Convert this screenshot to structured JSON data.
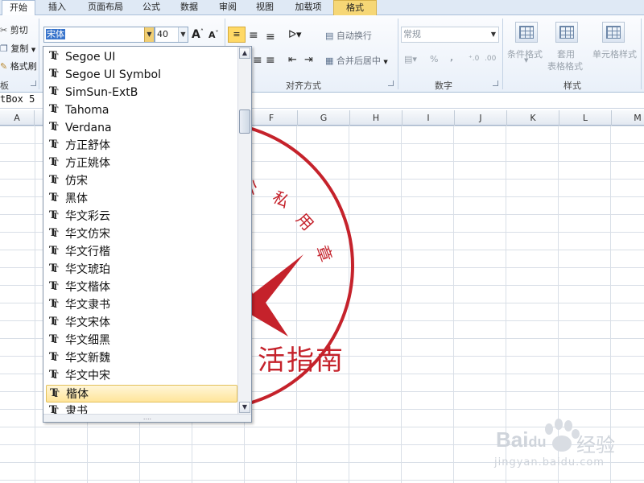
{
  "tabs": [
    {
      "label": "开始",
      "active": true
    },
    {
      "label": "插入"
    },
    {
      "label": "页面布局"
    },
    {
      "label": "公式"
    },
    {
      "label": "数据"
    },
    {
      "label": "审阅"
    },
    {
      "label": "视图"
    },
    {
      "label": "加载项"
    },
    {
      "label": "格式",
      "contextual": true
    }
  ],
  "clipboard": {
    "cut_label": "剪切",
    "copy_label": "复制",
    "format_painter_label": "格式刷",
    "group_label": "板"
  },
  "font": {
    "name_value": "宋体",
    "size_value": "40",
    "grow_label": "A",
    "shrink_label": "A"
  },
  "alignment": {
    "wrap_label": "自动换行",
    "merge_label": "合并后居中",
    "group_label": "对齐方式"
  },
  "number": {
    "format_value": "常规",
    "percent_label": "%",
    "comma_label": ",",
    "group_label": "数字"
  },
  "styles": {
    "conditional_label": "条件格式",
    "table_label_1": "套用",
    "table_label_2": "表格格式",
    "cell_styles_label": "单元格样式",
    "group_label": "样式"
  },
  "name_box": {
    "value": "tBox 5"
  },
  "columns": [
    "A",
    "F",
    "G",
    "H",
    "I",
    "J",
    "K",
    "L",
    "M"
  ],
  "stamp": {
    "arc_text": "公私用章",
    "bottom_text": "活指南",
    "color": "#c5222b"
  },
  "font_list": {
    "items": [
      {
        "name": "Segoe UI"
      },
      {
        "name": "Segoe UI Symbol"
      },
      {
        "name": "SimSun-ExtB"
      },
      {
        "name": "Tahoma"
      },
      {
        "name": "Verdana"
      },
      {
        "name": "方正舒体"
      },
      {
        "name": "方正姚体"
      },
      {
        "name": "仿宋"
      },
      {
        "name": "黑体"
      },
      {
        "name": "华文彩云"
      },
      {
        "name": "华文仿宋"
      },
      {
        "name": "华文行楷"
      },
      {
        "name": "华文琥珀"
      },
      {
        "name": "华文楷体"
      },
      {
        "name": "华文隶书"
      },
      {
        "name": "华文宋体"
      },
      {
        "name": "华文细黑"
      },
      {
        "name": "华文新魏"
      },
      {
        "name": "华文中宋"
      },
      {
        "name": "楷体",
        "highlighted": true
      },
      {
        "name": "隶书"
      }
    ],
    "grip_label": "....",
    "icon": "truetype-font-icon"
  },
  "watermark": {
    "brand": "Bai",
    "brand_suffix": "du",
    "product": "经验",
    "url": "jingyan.baidu.com"
  }
}
